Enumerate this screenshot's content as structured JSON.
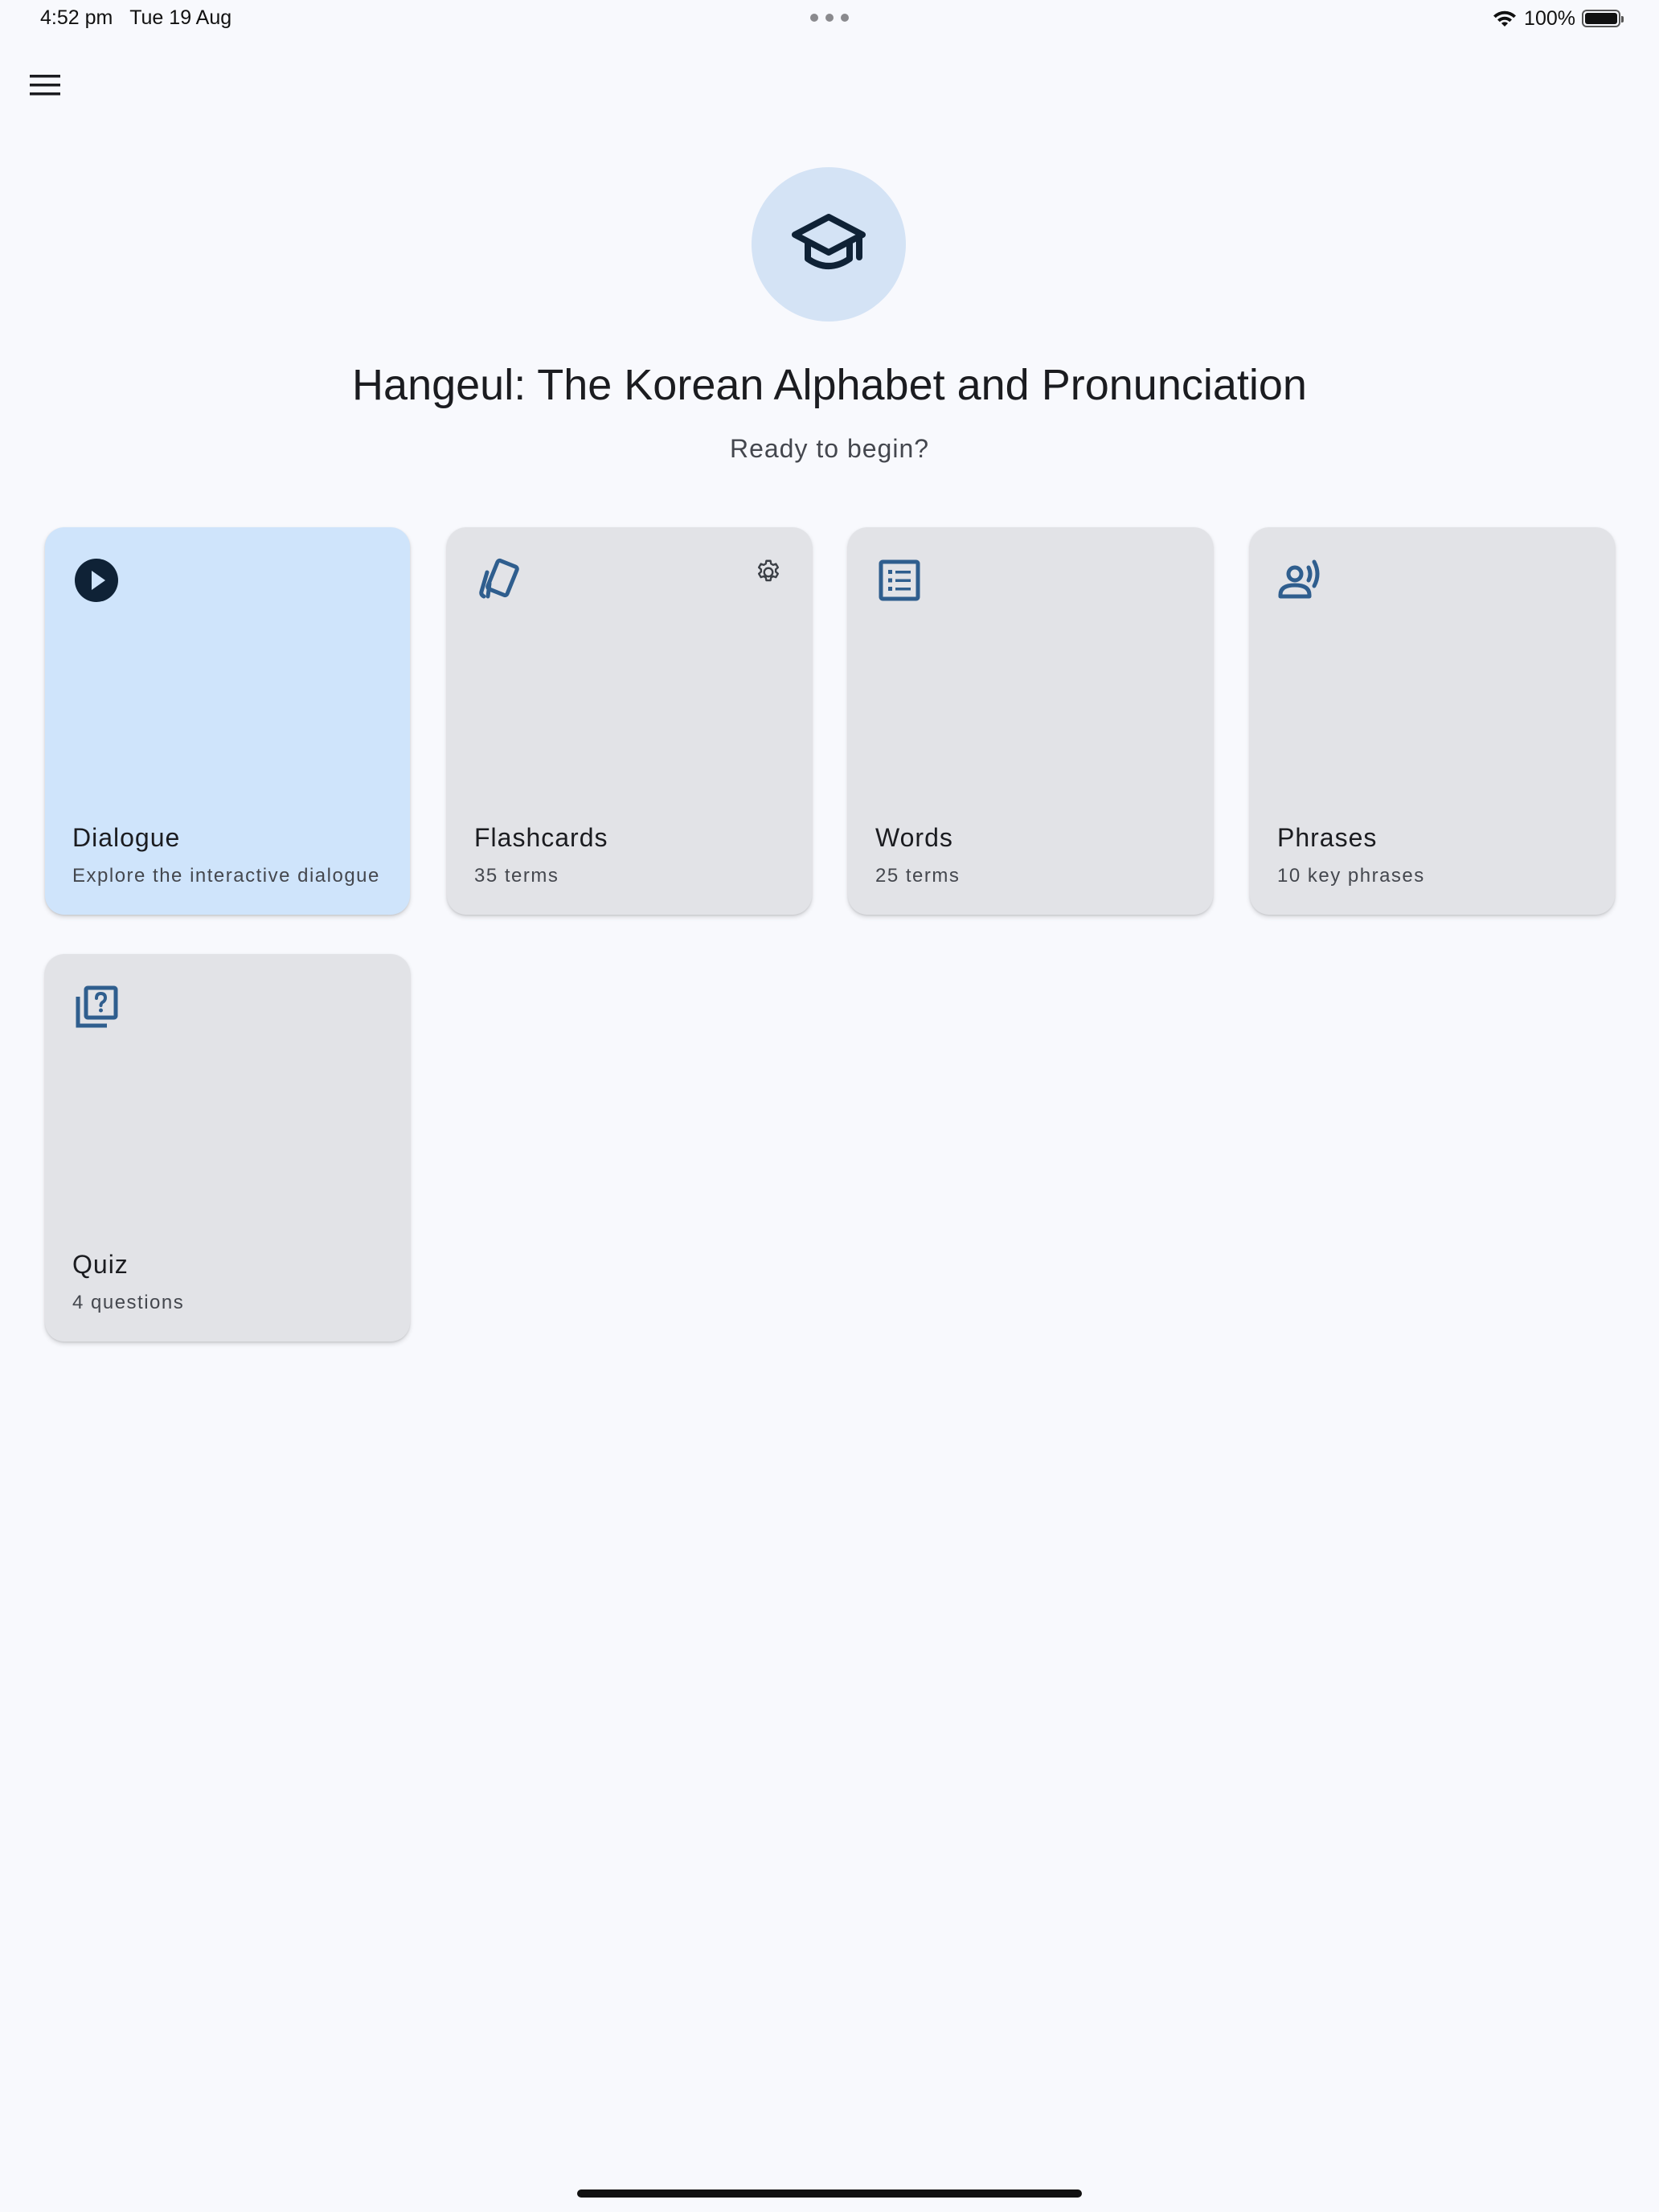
{
  "status_bar": {
    "time": "4:52 pm",
    "date": "Tue 19 Aug",
    "battery_percent": "100%",
    "battery_level": 1.0
  },
  "header": {
    "menu_icon": "hamburger-menu-icon"
  },
  "hero": {
    "icon": "graduation-cap-icon",
    "title": "Hangeul: The Korean Alphabet and Pronunciation",
    "subtitle": "Ready to begin?"
  },
  "colors": {
    "background": "#f8f9fd",
    "active_card": "#cfe4fb",
    "card": "#e2e3e7",
    "icon_accent": "#2f5e8e",
    "hero_circle": "#d4e3f5"
  },
  "cards": [
    {
      "title": "Dialogue",
      "subtitle": "Explore the interactive dialogue",
      "icon": "play-circle-icon",
      "active": true
    },
    {
      "title": "Flashcards",
      "subtitle": "35 terms",
      "icon": "flashcards-icon",
      "settings_icon": "gear-icon"
    },
    {
      "title": "Words",
      "subtitle": "25 terms",
      "icon": "list-icon"
    },
    {
      "title": "Phrases",
      "subtitle": "10 key phrases",
      "icon": "speaking-person-icon"
    },
    {
      "title": "Quiz",
      "subtitle": "4 questions",
      "icon": "quiz-icon"
    }
  ]
}
